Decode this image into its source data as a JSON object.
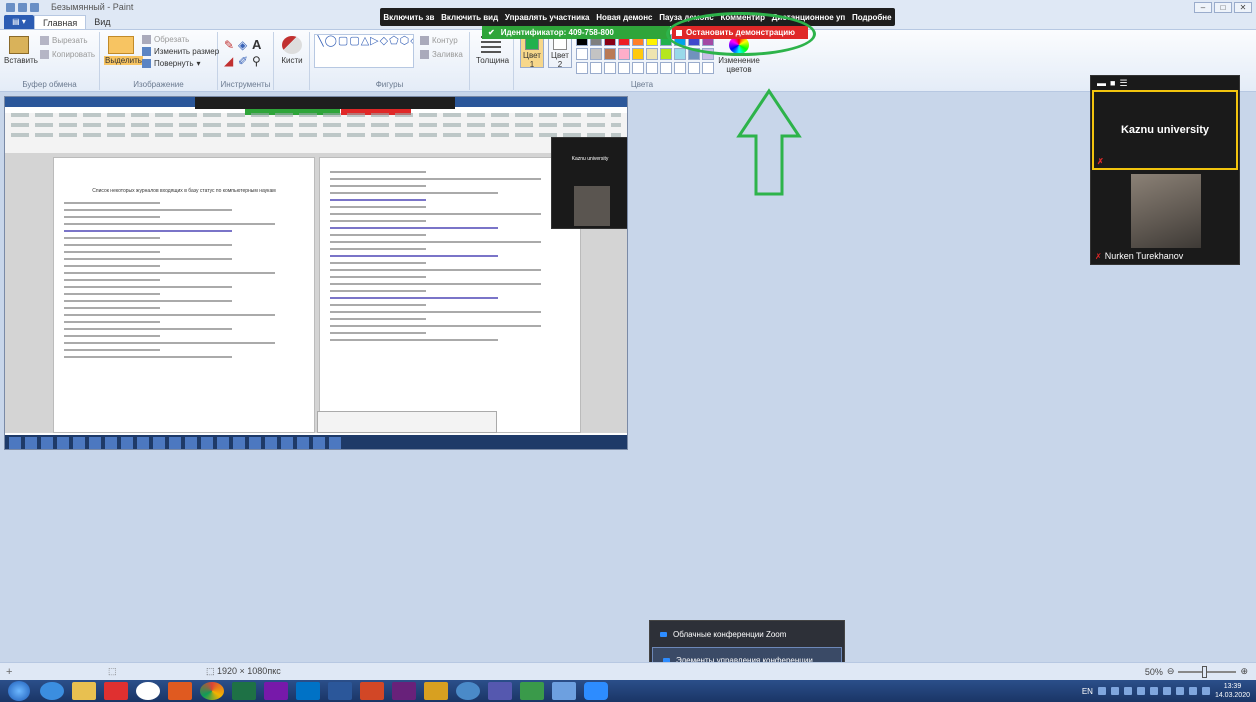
{
  "window": {
    "app_title": "Безымянный - Paint"
  },
  "tabs": {
    "file": "",
    "home": "Главная",
    "view": "Вид"
  },
  "ribbon": {
    "clipboard": {
      "paste": "Вставить",
      "cut": "Вырезать",
      "copy": "Копировать",
      "label": "Буфер обмена"
    },
    "image": {
      "select": "Выделить",
      "crop": "Обрезать",
      "resize": "Изменить размер",
      "rotate": "Повернуть",
      "label": "Изображение"
    },
    "tools": {
      "label": "Инструменты"
    },
    "brushes": {
      "label": "Кисти"
    },
    "shapes": {
      "outline": "Контур",
      "fill": "Заливка",
      "label": "Фигуры"
    },
    "thickness": "Толщина",
    "color1": "Цвет\n1",
    "color2": "Цвет\n2",
    "edit_colors": "Изменение цветов",
    "colors_label": "Цвета",
    "palette": [
      "#000000",
      "#7f7f7f",
      "#880015",
      "#ed1c24",
      "#ff7f27",
      "#fff200",
      "#22b14c",
      "#00a2e8",
      "#3f48cc",
      "#a349a4",
      "#ffffff",
      "#c3c3c3",
      "#b97a57",
      "#ffaec9",
      "#ffc90e",
      "#efe4b0",
      "#b5e61d",
      "#99d9ea",
      "#7092be",
      "#c8bfe7",
      "#ffffff",
      "#ffffff",
      "#ffffff",
      "#ffffff",
      "#ffffff",
      "#ffffff",
      "#ffffff",
      "#ffffff",
      "#ffffff",
      "#ffffff"
    ]
  },
  "zoom_toolbar": {
    "items": [
      "Включить зв",
      "Включить вид",
      "Управлять участника",
      "Новая демонс",
      "Пауза демонс",
      "Комментир",
      "Дистанционное уп",
      "Подробне"
    ],
    "meeting_id": "Идентификатор: 409-758-800",
    "stop_share": "Остановить демонстрацию"
  },
  "shared_doc": {
    "heading": "Список некоторых журналов входящих в базу статус по компьютерным наукам"
  },
  "zoom_panel": {
    "host_name": "Kaznu university",
    "participant_name": "Nurken Turekhanov"
  },
  "context_menu": {
    "items": [
      "Облачные конференции Zoom",
      "Элементы управления конференции"
    ]
  },
  "statusbar": {
    "dimensions": "1920 × 1080пкс",
    "zoom": "50%"
  },
  "tray": {
    "lang": "EN",
    "time": "13:39",
    "date": "14.03.2020"
  }
}
